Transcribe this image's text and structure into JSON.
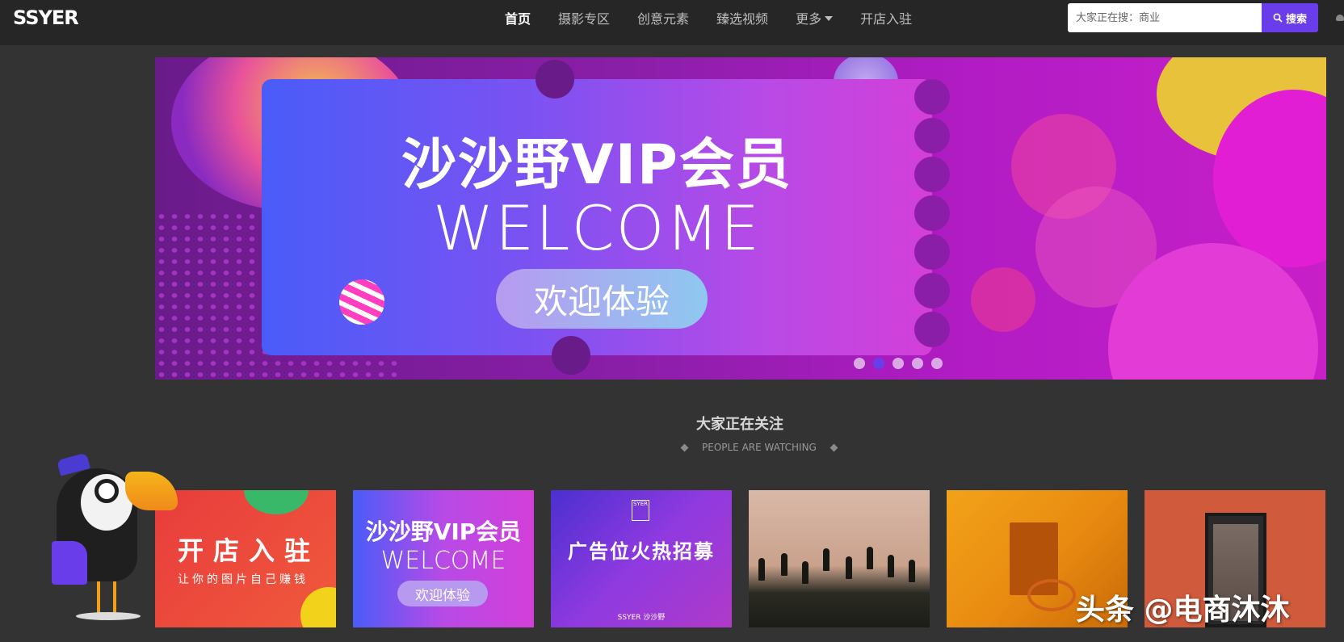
{
  "header": {
    "logo": "SSYER",
    "nav": [
      {
        "label": "首页"
      },
      {
        "label": "摄影专区"
      },
      {
        "label": "创意元素"
      },
      {
        "label": "臻选视频"
      },
      {
        "label": "更多"
      },
      {
        "label": "开店入驻"
      }
    ],
    "search": {
      "placeholder": "大家正在搜：商业",
      "button_label": "搜索"
    }
  },
  "banner": {
    "title": "沙沙野VIP会员",
    "subtitle": "WELCOME",
    "cta": "欢迎体验",
    "slide_count": 5,
    "active_slide": 2
  },
  "section": {
    "title": "大家正在关注",
    "subtitle": "PEOPLE ARE WATCHING"
  },
  "thumbs": [
    {
      "title": "开店入驻",
      "caption": "让你的图片自己赚钱"
    },
    {
      "title": "沙沙野VIP会员",
      "subtitle": "WELCOME",
      "cta": "欢迎体验"
    },
    {
      "logo": "SYER",
      "title": "广告位火热招募",
      "caption": "SSYER 沙沙野"
    },
    {},
    {},
    {}
  ],
  "watermark": "头条 @电商沐沐",
  "colors": {
    "accent": "#6a3dea",
    "header_bg": "#262626",
    "page_bg": "#333333"
  }
}
